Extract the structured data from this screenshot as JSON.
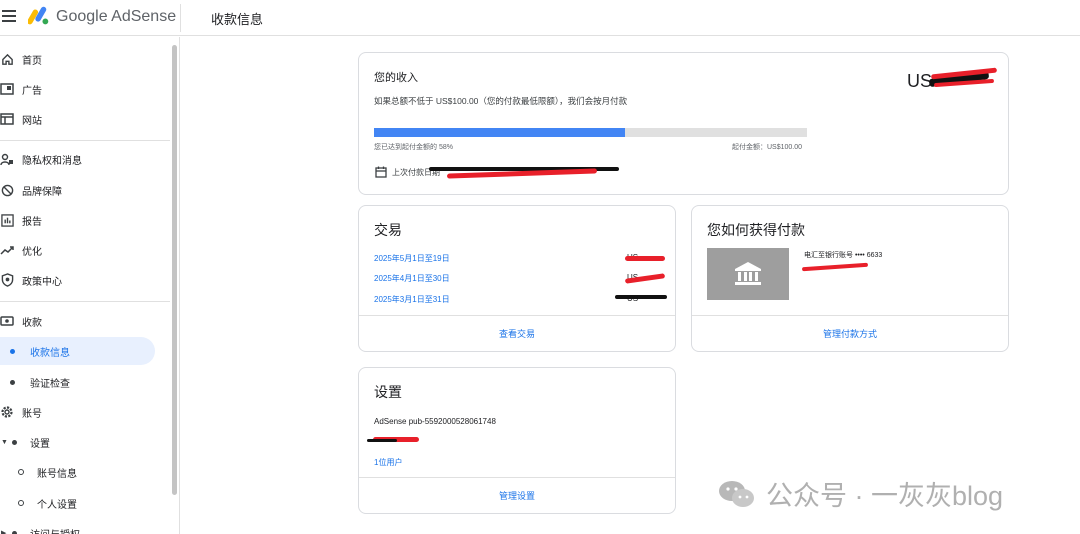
{
  "header": {
    "brand": "Google AdSense",
    "page_title": "收款信息"
  },
  "sidebar": {
    "items": [
      {
        "label": "首页",
        "icon": "home-icon"
      },
      {
        "label": "广告",
        "icon": "ads-icon"
      },
      {
        "label": "网站",
        "icon": "sites-icon"
      },
      {
        "label": "隐私权和消息",
        "icon": "privacy-icon"
      },
      {
        "label": "品牌保障",
        "icon": "block-icon"
      },
      {
        "label": "报告",
        "icon": "report-icon"
      },
      {
        "label": "优化",
        "icon": "trending-icon"
      },
      {
        "label": "政策中心",
        "icon": "shield-icon"
      },
      {
        "label": "收款",
        "icon": "payments-icon"
      },
      {
        "label": "收款信息",
        "active": true
      },
      {
        "label": "验证检查"
      },
      {
        "label": "账号",
        "icon": "gear-icon"
      },
      {
        "label": "设置"
      },
      {
        "label": "账号信息"
      },
      {
        "label": "个人设置"
      },
      {
        "label": "访问与授权"
      }
    ]
  },
  "earnings": {
    "title": "您的收入",
    "amount_prefix": "US",
    "description": "如果总额不低于 US$100.00（您的付款最低限额），我们会按月付款",
    "progress_fraction": 0.58,
    "progress_text": "您已达到起付金额的 58%",
    "threshold_text": "起付金额：US$100.00",
    "last_payment_label": "上次付款日期"
  },
  "transactions": {
    "title": "交易",
    "rows": [
      {
        "period": "2025年5月1日至19日",
        "amount": "US"
      },
      {
        "period": "2025年4月1日至30日",
        "amount": "US"
      },
      {
        "period": "2025年3月1日至31日",
        "amount": "US"
      }
    ],
    "footer_link": "查看交易"
  },
  "payment_method": {
    "title": "您如何获得付款",
    "account": "电汇至银行账号 •••• 6633",
    "footer_link": "管理付款方式"
  },
  "settings": {
    "title": "设置",
    "publisher_id": "AdSense pub-5592000528061748",
    "users_link": "1位用户",
    "footer_link": "管理设置"
  },
  "watermark": {
    "text": "公众号 · 一灰灰blog"
  },
  "colors": {
    "accent": "#1a73e8",
    "progress": "#4285f4",
    "redaction": "#e8202a"
  }
}
